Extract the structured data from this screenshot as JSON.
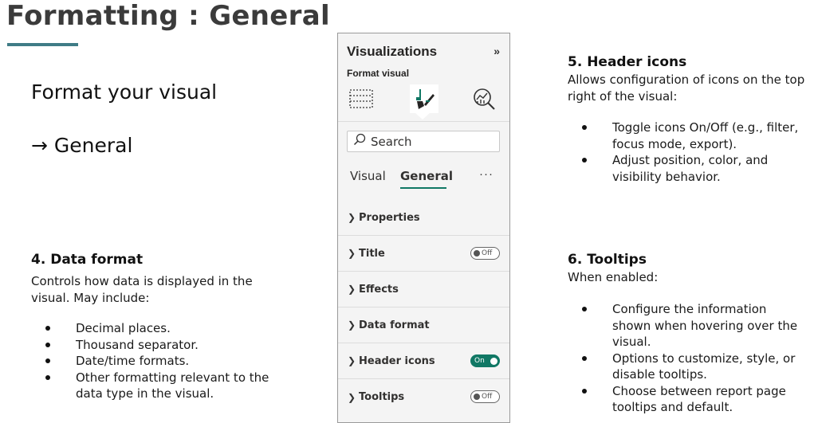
{
  "slide": {
    "title": "Formatting : General",
    "subtitle1": "Format your visual",
    "subtitle2": "→ General"
  },
  "data_format": {
    "heading": "4. Data format",
    "desc": "Controls how data is displayed in the visual. May include:",
    "bullets": [
      "Decimal places.",
      "Thousand separator.",
      "Date/time formats.",
      "Other formatting relevant to the data type in the visual."
    ]
  },
  "header_icons": {
    "heading": "5. Header icons",
    "desc": "Allows configuration of icons on the top right of the visual:",
    "bullets": [
      "Toggle icons On/Off (e.g., filter, focus mode, export).",
      "Adjust position, color, and visibility behavior."
    ]
  },
  "tooltips": {
    "heading": "6. Tooltips",
    "desc": "When enabled:",
    "bullets": [
      "Configure the information shown when hovering over the visual.",
      "Options to customize, style, or disable tooltips.",
      "Choose between report page tooltips and default."
    ]
  },
  "pane": {
    "title": "Visualizations",
    "collapse_icon": "double-chevron-right",
    "format_visual_label": "Format visual",
    "icons": [
      "build-visual-icon",
      "format-brush-icon",
      "analytics-icon"
    ],
    "search_placeholder": "Search",
    "tabs": [
      {
        "label": "Visual",
        "active": false
      },
      {
        "label": "General",
        "active": true
      }
    ],
    "more": "···",
    "sections": [
      {
        "label": "Properties",
        "toggle": null
      },
      {
        "label": "Title",
        "toggle": "Off"
      },
      {
        "label": "Effects",
        "toggle": null
      },
      {
        "label": "Data format",
        "toggle": null
      },
      {
        "label": "Header icons",
        "toggle": "On"
      },
      {
        "label": "Tooltips",
        "toggle": "Off"
      }
    ],
    "accent_color": "#117865"
  }
}
